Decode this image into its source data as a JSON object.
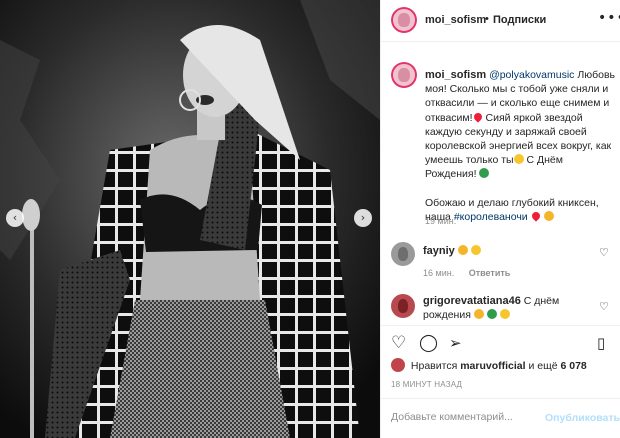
{
  "post": {
    "username": "moi_sofism",
    "dot": "•",
    "follow_label": "Подписки",
    "more_icon": "more-horizontal-icon"
  },
  "caption": {
    "username": "moi_sofism",
    "mention": "@polyakovamusic",
    "text_1": "Любовь моя! Сколько мы с тобой уже сняли и отквасили — и сколько еще снимем и отквасим!",
    "text_2": " Сияй яркой звездой каждую секунду и заряжай своей королевской энергией всех вокруг, как умеешь только ты",
    "text_3": " С Днём Рождения!",
    "text_4": "Обожаю и делаю глубокий книксен, наша ",
    "hashtag": "#королеваночи",
    "time": "19 мин."
  },
  "comments": [
    {
      "username": "fayniy",
      "text": "",
      "time": "16 мин.",
      "reply_label": "Ответить"
    },
    {
      "username": "grigorevatatiana46",
      "text": "С днём рождения",
      "time": "",
      "reply_label": ""
    }
  ],
  "actions": {
    "like_icon": "heart-icon",
    "comment_icon": "comment-icon",
    "share_icon": "send-icon",
    "save_icon": "bookmark-icon"
  },
  "likes": {
    "prefix": "Нравится",
    "user": "maruvofficial",
    "suffix": "и ещё",
    "count": "6 078"
  },
  "post_time": "18 МИНУТ НАЗАД",
  "add_comment": {
    "placeholder": "Добавьте комментарий...",
    "publish_label": "Опубликовать"
  },
  "colors": {
    "link": "#00376b",
    "muted": "#8e8e8e",
    "publish_disabled": "#b2dffc",
    "story_ring": "#e2336b"
  }
}
